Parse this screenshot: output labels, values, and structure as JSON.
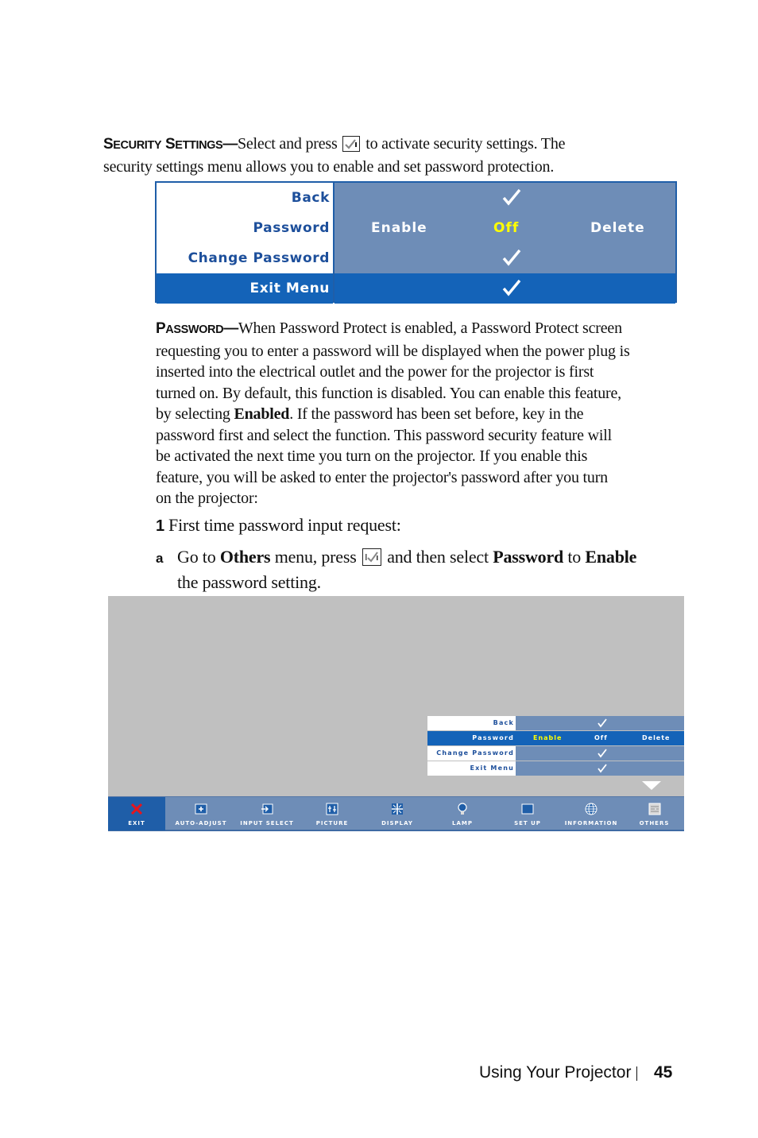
{
  "section1": {
    "heading": "Security Settings",
    "dash": "—",
    "text_before_icon": "Select and press ",
    "icon": "enter-checkmark-icon",
    "text_after_icon": " to activate security settings. The",
    "line2": "security settings menu allows you to enable and set password protection."
  },
  "security_menu": {
    "rows": [
      {
        "label": "Back",
        "value": "check"
      },
      {
        "label": "Password",
        "options": [
          "Enable",
          "Off",
          "Delete"
        ],
        "active_option": "Off"
      },
      {
        "label": "Change Password",
        "value": "check"
      },
      {
        "label": "Exit Menu",
        "value": "check",
        "selected": true
      }
    ],
    "colors": {
      "label_bg": "#ffffff",
      "label_text": "#1d4f9b",
      "value_bg": "#6e8db7",
      "selected_bg": "#1463b8",
      "active_option": "#ffff00"
    }
  },
  "section2": {
    "heading": "Password",
    "dash": "—",
    "lines": [
      "When Password Protect is enabled, a Password Protect screen",
      "requesting you to enter a password will be displayed when the power plug is",
      "inserted into the electrical outlet and the power for the projector is first",
      "turned on. By default, this function is disabled. You can enable this feature,"
    ],
    "line5_pre": "by selecting ",
    "line5_bold": "Enabled",
    "line5_post": ". If the password has been set before, key in the",
    "lines_after": [
      "password first and select the function. This password security feature will",
      "be activated the next time you turn on the projector. If you enable this",
      "feature, you will be asked to enter the projector's password after you turn",
      "on the projector:"
    ]
  },
  "steps": {
    "step1_num": "1",
    "step1_text": "First time password input request:",
    "stepa_letter": "a",
    "stepa_t1": "Go to ",
    "stepa_b1": "Others",
    "stepa_t2": " menu, press ",
    "stepa_t3": " and then select ",
    "stepa_b2": "Password",
    "stepa_t4": " to ",
    "stepa_b3": "Enable",
    "stepa_line2": "the password setting."
  },
  "screen_menu": {
    "rows": [
      {
        "label": "Back",
        "value": "check"
      },
      {
        "label": "Password",
        "options": [
          "Enable",
          "Off",
          "Delete"
        ],
        "active_option": "Enable",
        "selected": true
      },
      {
        "label": "Change Password",
        "value": "check"
      },
      {
        "label": "Exit Menu",
        "value": "check"
      }
    ],
    "menubar": [
      {
        "label": "EXIT",
        "icon": "close-x-icon",
        "selected": true
      },
      {
        "label": "AUTO-ADJUST",
        "icon": "auto-adjust-icon"
      },
      {
        "label": "INPUT SELECT",
        "icon": "input-select-icon"
      },
      {
        "label": "PICTURE",
        "icon": "picture-icon"
      },
      {
        "label": "DISPLAY",
        "icon": "display-icon"
      },
      {
        "label": "LAMP",
        "icon": "lamp-bulb-icon"
      },
      {
        "label": "SET UP",
        "icon": "setup-icon"
      },
      {
        "label": "INFORMATION",
        "icon": "globe-icon"
      },
      {
        "label": "OTHERS",
        "icon": "others-icon"
      }
    ]
  },
  "footer": {
    "chapter": "Using Your Projector",
    "page_number": "45"
  }
}
